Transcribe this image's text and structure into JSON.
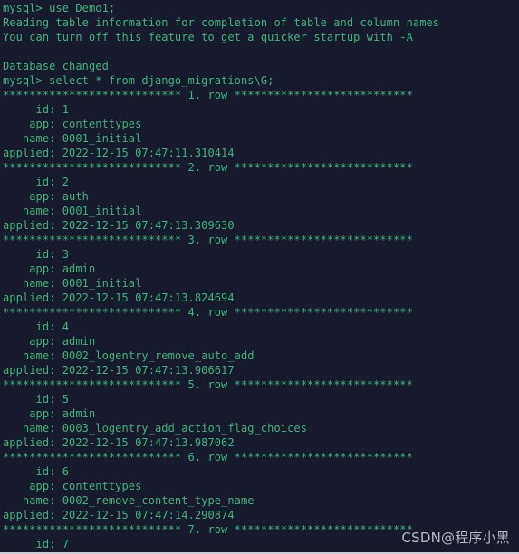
{
  "terminal": {
    "background_color": "#161a2c",
    "text_color": "#3fb477",
    "prompt": "mysql>",
    "separator_char": "*",
    "separator_side_count": 27,
    "field_label_width": 7,
    "lines": [
      "mysql> use Demo1;",
      "Reading table information for completion of table and column names",
      "You can turn off this feature to get a quicker startup with -A",
      "",
      "Database changed",
      "mysql> select * from django_migrations\\G;",
      "*************************** 1. row ***************************",
      "     id: 1",
      "    app: contenttypes",
      "   name: 0001_initial",
      "applied: 2022-12-15 07:47:11.310414",
      "*************************** 2. row ***************************",
      "     id: 2",
      "    app: auth",
      "   name: 0001_initial",
      "applied: 2022-12-15 07:47:13.309630",
      "*************************** 3. row ***************************",
      "     id: 3",
      "    app: admin",
      "   name: 0001_initial",
      "applied: 2022-12-15 07:47:13.824694",
      "*************************** 4. row ***************************",
      "     id: 4",
      "    app: admin",
      "   name: 0002_logentry_remove_auto_add",
      "applied: 2022-12-15 07:47:13.906617",
      "*************************** 5. row ***************************",
      "     id: 5",
      "    app: admin",
      "   name: 0003_logentry_add_action_flag_choices",
      "applied: 2022-12-15 07:47:13.987062",
      "*************************** 6. row ***************************",
      "     id: 6",
      "    app: contenttypes",
      "   name: 0002_remove_content_type_name",
      "applied: 2022-12-15 07:47:14.290874",
      "*************************** 7. row ***************************",
      "     id: 7"
    ],
    "commands": [
      "use Demo1;",
      "select * from django_migrations\\G;"
    ],
    "database": "Demo1",
    "table": "django_migrations",
    "messages": [
      "Reading table information for completion of table and column names",
      "You can turn off this feature to get a quicker startup with -A",
      "Database changed"
    ],
    "columns": [
      "id",
      "app",
      "name",
      "applied"
    ],
    "rows": [
      {
        "row_number": "1. row",
        "id": "1",
        "app": "contenttypes",
        "name": "0001_initial",
        "applied": "2022-12-15 07:47:11.310414"
      },
      {
        "row_number": "2. row",
        "id": "2",
        "app": "auth",
        "name": "0001_initial",
        "applied": "2022-12-15 07:47:13.309630"
      },
      {
        "row_number": "3. row",
        "id": "3",
        "app": "admin",
        "name": "0001_initial",
        "applied": "2022-12-15 07:47:13.824694"
      },
      {
        "row_number": "4. row",
        "id": "4",
        "app": "admin",
        "name": "0002_logentry_remove_auto_add",
        "applied": "2022-12-15 07:47:13.906617"
      },
      {
        "row_number": "5. row",
        "id": "5",
        "app": "admin",
        "name": "0003_logentry_add_action_flag_choices",
        "applied": "2022-12-15 07:47:13.987062"
      },
      {
        "row_number": "6. row",
        "id": "6",
        "app": "contenttypes",
        "name": "0002_remove_content_type_name",
        "applied": "2022-12-15 07:47:14.290874"
      },
      {
        "row_number": "7. row",
        "id": "7",
        "app": "",
        "name": "",
        "applied": ""
      }
    ]
  },
  "watermark": {
    "text": "CSDN@程序小黑",
    "color": "#c6c8cf"
  }
}
